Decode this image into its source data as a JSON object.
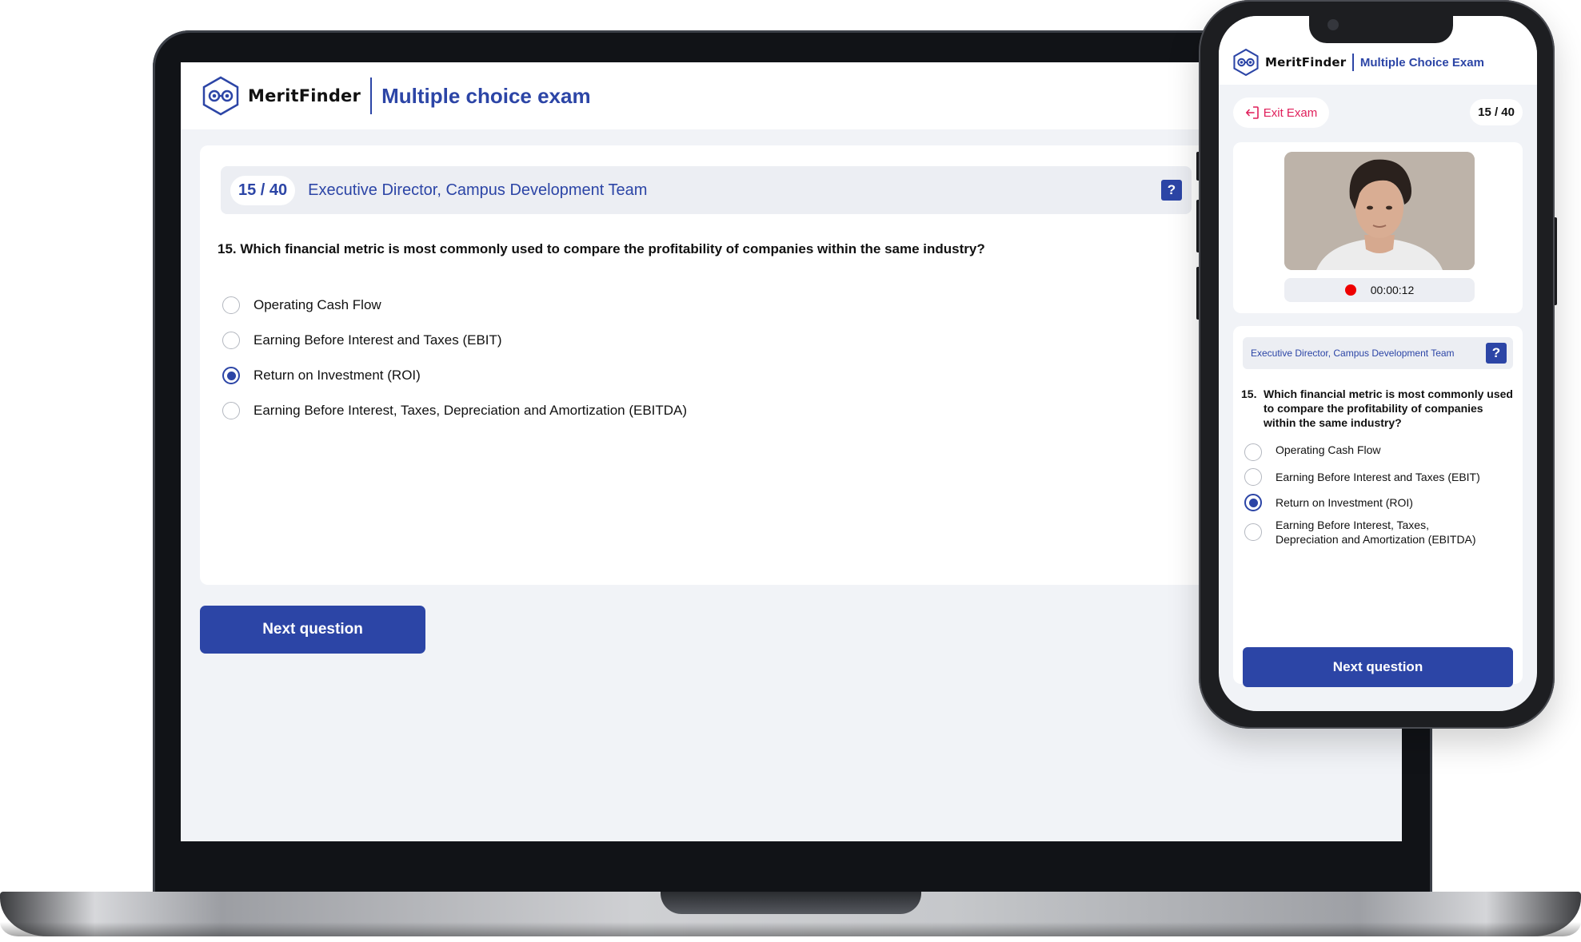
{
  "brand": {
    "logo_text": "MeritFinder",
    "accent_color": "#2c45a6",
    "danger_color": "#e01e5a"
  },
  "desktop": {
    "page_title": "Multiple choice exam",
    "counter": "15 / 40",
    "position_title": "Executive Director, Campus Development Team",
    "help_label": "?",
    "question": "15.  Which financial metric is most commonly used to compare the profitability of companies within the same industry?",
    "options": [
      {
        "label": "Operating Cash Flow",
        "selected": false
      },
      {
        "label": "Earning Before Interest and Taxes (EBIT)",
        "selected": false
      },
      {
        "label": "Return on Investment (ROI)",
        "selected": true
      },
      {
        "label": "Earning Before Interest, Taxes, Depreciation and Amortization (EBITDA)",
        "selected": false
      }
    ],
    "next_label": "Next question"
  },
  "mobile": {
    "page_title": "Multiple Choice Exam",
    "exit_label": "Exit Exam",
    "counter": "15 / 40",
    "timer": "00:00:12",
    "position_title": "Executive Director, Campus Development Team",
    "help_label": "?",
    "question_number": "15.",
    "question_text": "Which financial metric is most commonly used to compare the profitability of companies within the same industry?",
    "options": [
      {
        "label": "Operating Cash Flow",
        "selected": false
      },
      {
        "label": "Earning Before Interest and Taxes (EBIT)",
        "selected": false
      },
      {
        "label": "Return on Investment (ROI)",
        "selected": true
      },
      {
        "label": "Earning Before Interest, Taxes, Depreciation and Amortization (EBITDA)",
        "selected": false
      }
    ],
    "next_label": "Next question"
  }
}
